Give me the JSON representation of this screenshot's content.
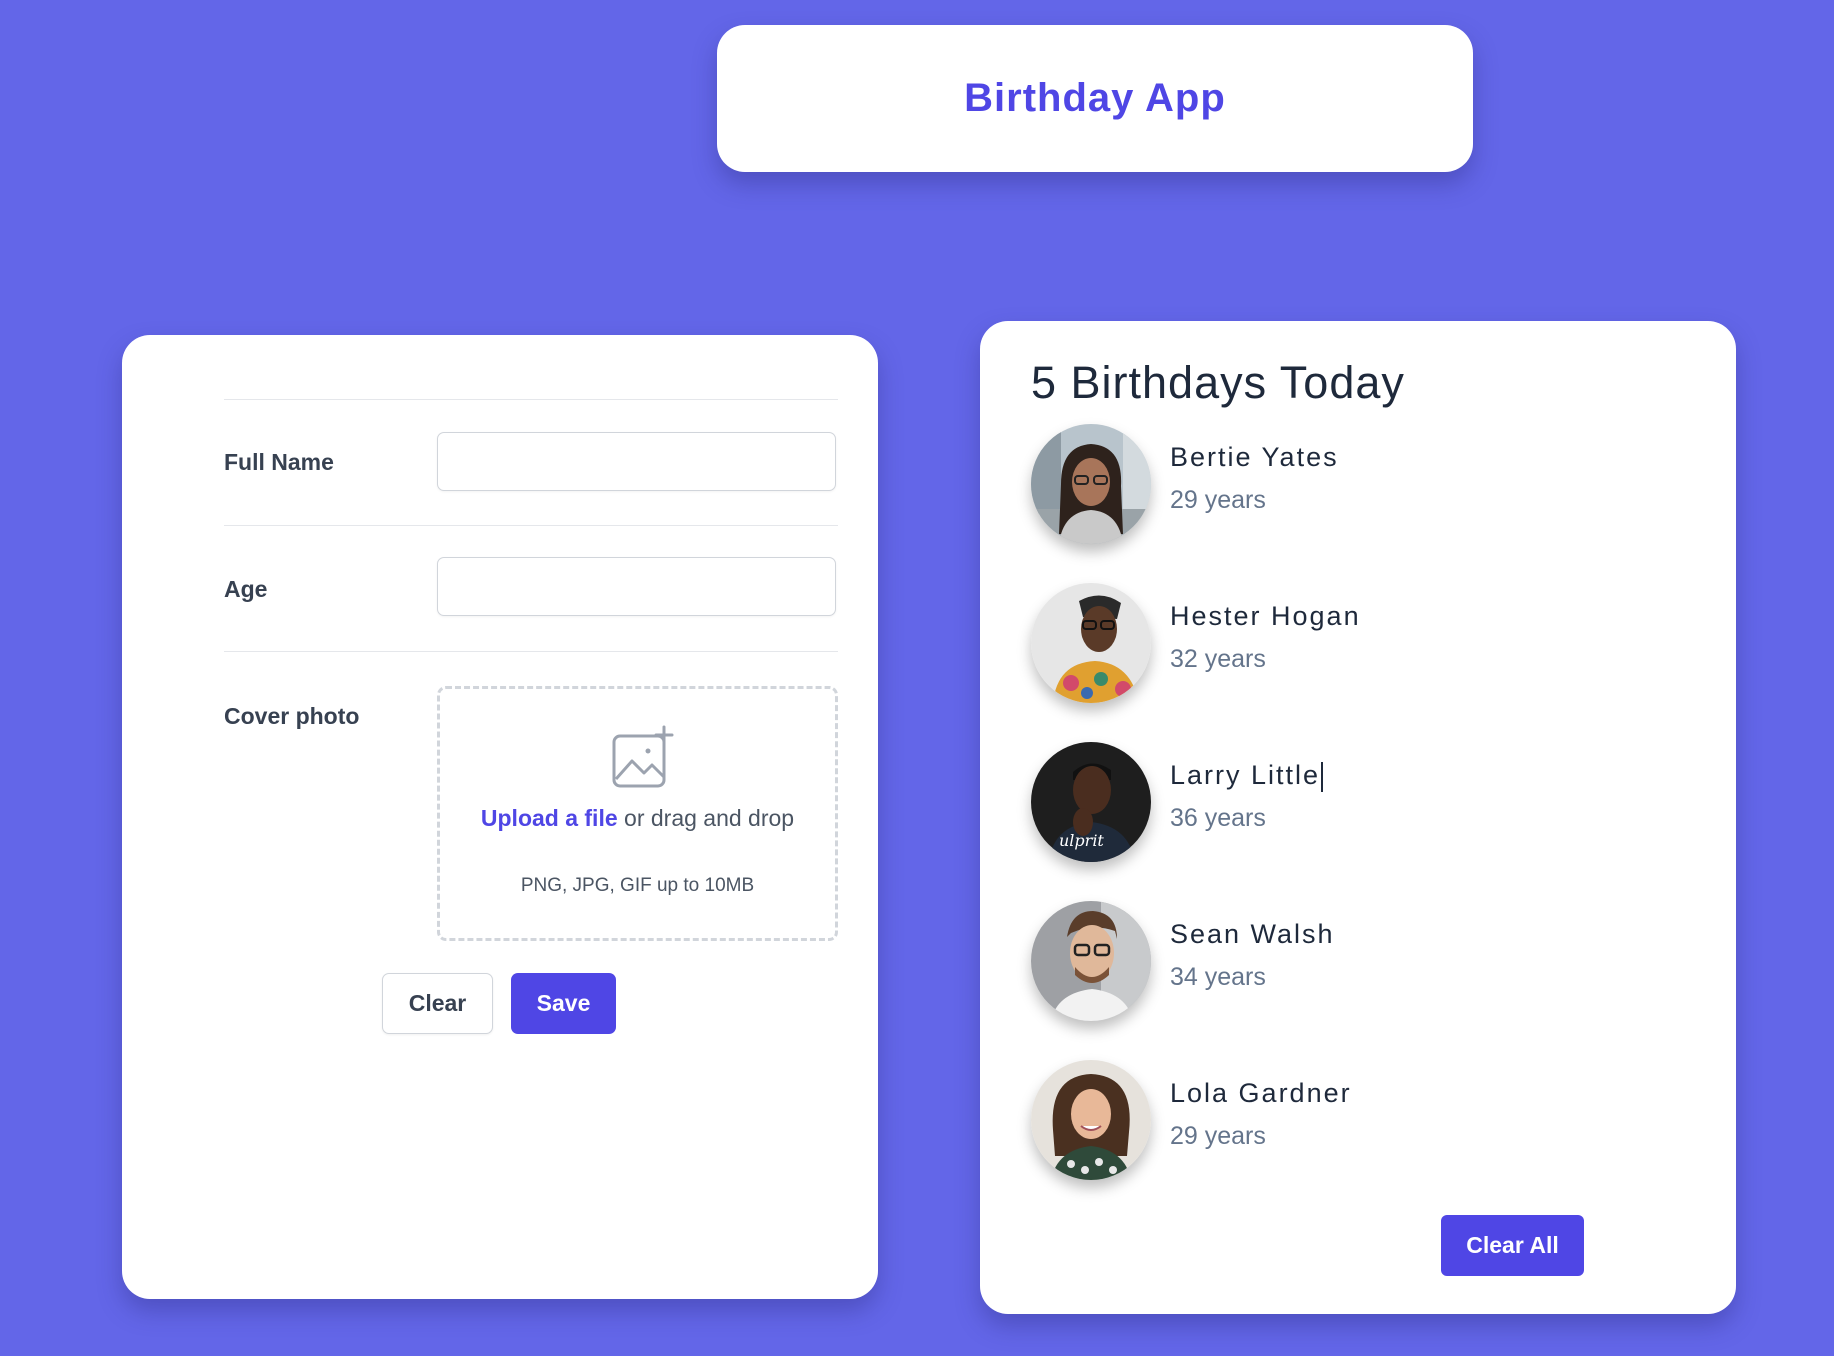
{
  "header": {
    "title": "Birthday App"
  },
  "form": {
    "full_name_label": "Full Name",
    "full_name_value": "",
    "age_label": "Age",
    "age_value": "",
    "cover_photo_label": "Cover photo",
    "upload_link": "Upload a file",
    "upload_text": " or drag and drop",
    "upload_hint": "PNG, JPG, GIF up to 10MB",
    "upload_icon": "image-add-icon",
    "clear_label": "Clear",
    "save_label": "Save"
  },
  "birthdays": {
    "title": "5 Birthdays Today",
    "people": [
      {
        "name": "Bertie Yates",
        "age": "29 years",
        "avatar_icon": "avatar-photo"
      },
      {
        "name": "Hester Hogan",
        "age": "32 years",
        "avatar_icon": "avatar-photo"
      },
      {
        "name": "Larry Little",
        "age": "36 years",
        "avatar_icon": "avatar-photo"
      },
      {
        "name": "Sean Walsh",
        "age": "34 years",
        "avatar_icon": "avatar-photo"
      },
      {
        "name": "Lola Gardner",
        "age": "29 years",
        "avatar_icon": "avatar-photo"
      }
    ],
    "clear_all_label": "Clear All"
  },
  "colors": {
    "background": "#6366e8",
    "accent": "#4f46e5",
    "card": "#ffffff"
  }
}
